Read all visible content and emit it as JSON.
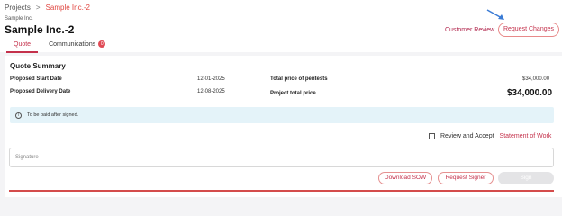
{
  "breadcrumb": {
    "root": "Projects",
    "separator": ">",
    "current": "Sample Inc.-2"
  },
  "company": {
    "small_name": "Sample Inc.",
    "title": "Sample Inc.-2"
  },
  "tabs": [
    {
      "label": "Quote",
      "active": true
    },
    {
      "label": "Communications",
      "badge": "0"
    }
  ],
  "header_actions": {
    "customer_review": "Customer Review",
    "request_changes": "Request Changes"
  },
  "summary": {
    "title": "Quote Summary",
    "start_label": "Proposed Start Date",
    "start_value": "12-01-2025",
    "delivery_label": "Proposed Delivery Date",
    "delivery_value": "12-08-2025",
    "pentest_label": "Total price of pentests",
    "pentest_value": "$34,000.00",
    "total_label": "Project total price",
    "total_value": "$34,000.00"
  },
  "info": {
    "icon": "info-icon",
    "text": "To be paid after signed."
  },
  "review": {
    "prefix": "Review and Accept",
    "link": "Statement of Work"
  },
  "signature": {
    "placeholder": "Signature"
  },
  "buttons": {
    "download": "Download SOW",
    "request_signer": "Request Signer",
    "sign": "Sign"
  },
  "colors": {
    "accent": "#c4314b",
    "info_bg": "#e4f3f9",
    "arrow": "#3a7bd5"
  }
}
